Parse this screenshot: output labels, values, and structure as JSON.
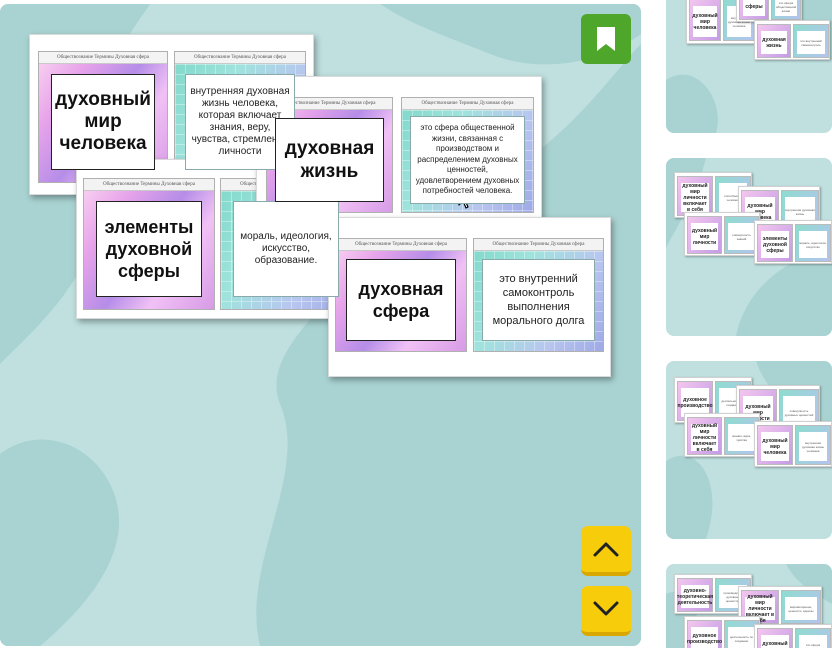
{
  "colors": {
    "panel_bg": "#bfe0df",
    "panel_shape": "#a9d3d2",
    "bookmark": "#4ea62a",
    "nav": "#f7cd0b"
  },
  "card_strip_text": "Обществознание   Термины   Духовная сфера",
  "slide": {
    "sheets": [
      {
        "term": "духовный мир человека",
        "definition": "внутренняя духовная жизнь человека, которая включает знания, веру, чувства, стремления личности"
      },
      {
        "term": "духовная жизнь",
        "definition": "это сфера общественной жизни, связанная с производством и распределением духовных ценностей, удовлетворением духовных потребностей человека."
      },
      {
        "term": "элементы духовной сферы",
        "definition": "мораль, идеология, искусство, образование."
      },
      {
        "term": "духовная сфера",
        "definition": "это внутренний самоконтроль выполнения морального долга"
      }
    ]
  },
  "buttons": {
    "bookmark_icon": "bookmark-icon",
    "up_icon": "chevron-up-icon",
    "down_icon": "chevron-down-icon"
  },
  "thumbnails": [
    {
      "terms": [
        "духовный мир человека",
        "сферы",
        "духовная жизнь"
      ]
    },
    {
      "terms": [
        "духовный мир личности включает в себя",
        "духовный мир человека",
        "духовный мир личности",
        "элементы духовной сферы"
      ]
    },
    {
      "terms": [
        "духовное производство",
        "духовный мир личности",
        "духовный мир личности включает в себя",
        "духовный мир человека"
      ]
    },
    {
      "terms": [
        "духовно-теоретическая деятельность",
        "духовный мир личности включает в себя",
        "духовное производство",
        "духовный мир"
      ]
    }
  ]
}
